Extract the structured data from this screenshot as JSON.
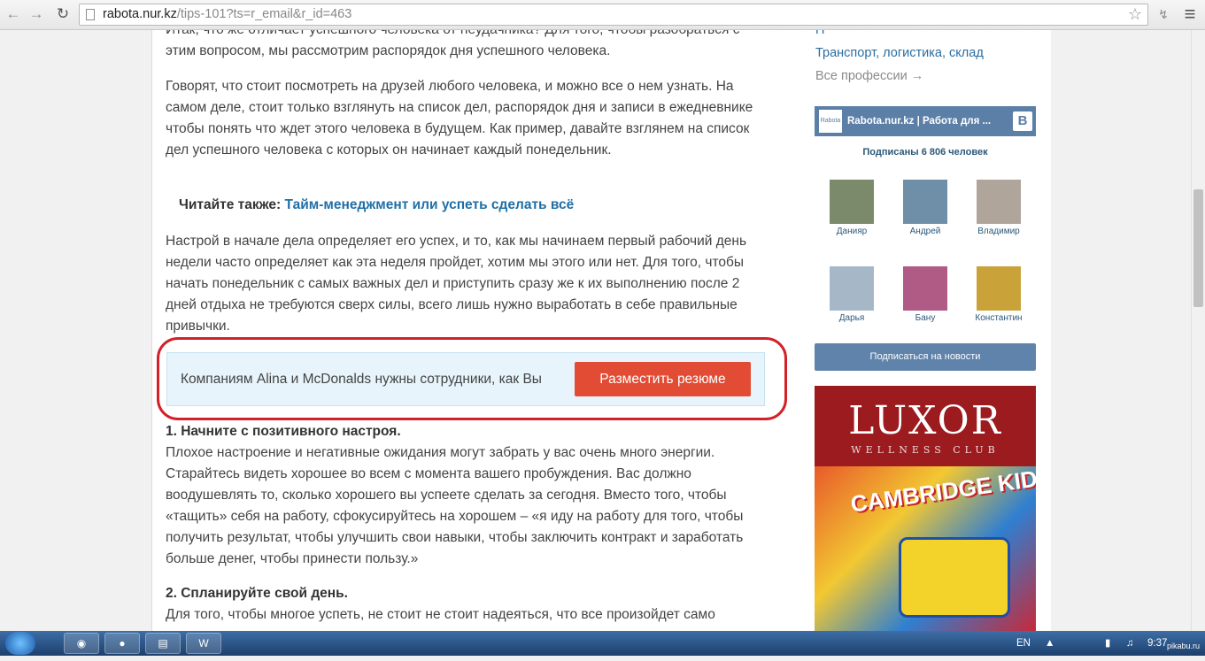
{
  "browser": {
    "url_host": "rabota.nur.kz",
    "url_path": "/tips-101?ts=r_email&r_id=463",
    "back_icon": "←",
    "forward_icon": "→",
    "reload_icon": "↻",
    "star_icon": "☆",
    "menu_icon": "≡"
  },
  "article": {
    "p0": "Итак, что же отличает успешного человека от неудачника? Для того, чтобы разобраться с этим вопросом, мы рассмотрим распорядок дня успешного человека.",
    "p1": "Говорят, что стоит посмотреть на друзей любого человека, и можно все о нем узнать. На самом деле, стоит только взглянуть на список дел, распорядок дня и записи в ежедневнике чтобы понять что ждет этого человека в будущем. Как пример, давайте взглянем на список дел успешного человека с которых он начинает каждый понедельник.",
    "read_also_label": "Читайте также:",
    "read_also_link": "Тайм-менеджмент или успеть сделать всё",
    "p2": "Настрой в начале дела определяет его успех, и то, как мы начинаем первый рабочий день недели часто определяет как эта неделя пройдет, хотим мы этого или нет. Для того, чтобы начать понедельник с самых важных дел и приступить сразу же к их выполнению после 2 дней отдыха не требуются сверх силы, всего лишь нужно выработать в себе правильные привычки.",
    "promo_text": "Компаниям Alina и McDonalds нужны сотрудники, как Вы",
    "promo_button": "Разместить резюме",
    "h1": "1. Начните с позитивного настроя.",
    "p3": "Плохое настроение и негативные ожидания могут забрать у вас очень много энергии. Старайтесь видеть хорошее во всем с момента вашего пробуждения. Вас должно воодушевлять то, сколько хорошего вы успеете сделать за сегодня. Вместо того, чтобы «тащить» себя на работу, сфокусируйтесь на хорошем – «я иду на работу для того, чтобы получить результат, чтобы улучшить свои навыки, чтобы заключить контракт и заработать больше денег, чтобы принести пользу.»",
    "h2": "2. Спланируйте свой день.",
    "p4": "Для того, чтобы многое успеть, не стоит не стоит надеяться, что все произойдет само"
  },
  "sidebar": {
    "cut_link": "П",
    "transport_link": "Транспорт, логистика, склад",
    "all_professions": "Все профессии →",
    "vk": {
      "logo_text": "Rabota",
      "title": "Rabota.nur.kz | Работа для ...",
      "b_label": "B",
      "subscribers": "Подписаны 6 806 человек",
      "members": [
        "Данияр",
        "Андрей",
        "Владимир",
        "Дарья",
        "Бану",
        "Константин"
      ],
      "subscribe_button": "Подписаться на новости"
    },
    "ad": {
      "brand": "LUXOR",
      "subtitle": "WELLNESS CLUB",
      "kids_text": "CAMBRIDGE KIDS"
    }
  },
  "taskbar": {
    "lang": "EN",
    "clock": "9:37",
    "watermark": "pikabu.ru"
  }
}
